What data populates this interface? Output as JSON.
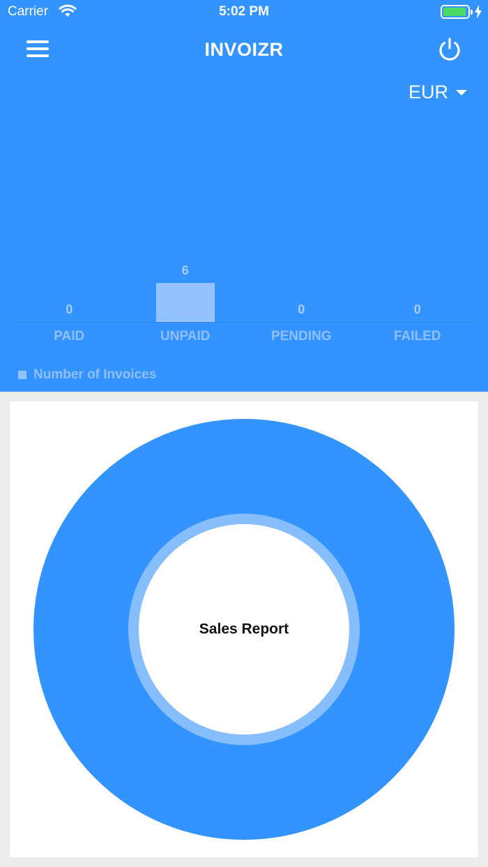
{
  "status_bar": {
    "carrier": "Carrier",
    "time": "5:02 PM"
  },
  "header": {
    "title": "INVOIZR",
    "menu_icon": "hamburger-menu-icon",
    "power_icon": "power-icon"
  },
  "currency_selector": {
    "value": "EUR"
  },
  "colors": {
    "primary": "#3393ff",
    "bar": "#93c3fc",
    "donut_inner_ring": "#86bdfd"
  },
  "chart_data": {
    "type": "bar",
    "categories": [
      "PAID",
      "UNPAID",
      "PENDING",
      "FAILED"
    ],
    "series": [
      {
        "name": "Number of Invoices",
        "values": [
          0,
          6,
          0,
          0
        ]
      }
    ],
    "legend": "bottom-left",
    "grid": false
  },
  "sales_report": {
    "center_label": "Sales Report"
  }
}
